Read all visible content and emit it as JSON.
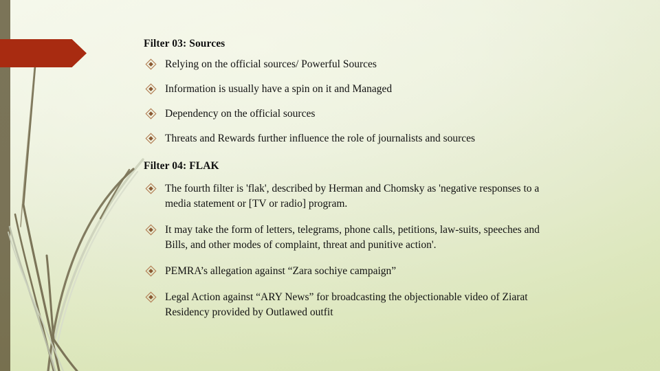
{
  "slide": {
    "background_color": "#e9eed8",
    "left_bar_color": "#7b7458",
    "accent_color": "#a82b11",
    "bullet_glyph": "diamond-in-diamond",
    "bullet_glyph_color": "#b5835a"
  },
  "sections": [
    {
      "heading": "Filter 03: Sources",
      "bullets": [
        {
          "text": "Relying on the official sources/ Powerful Sources",
          "justified": false
        },
        {
          "text": "Information is usually have a spin on it  and Managed",
          "justified": false
        },
        {
          "text": "Dependency on the official sources",
          "justified": false
        },
        {
          "text": "Threats and Rewards further influence the role of journalists and sources",
          "justified": false
        }
      ]
    },
    {
      "heading": "Filter 04: FLAK",
      "bullets": [
        {
          "text": "The fourth filter is 'flak', described by Herman and Chomsky as 'negative responses to a",
          "last_line": "media statement or [TV or radio] program.",
          "justified": true
        },
        {
          "text": "It may take the form of letters, telegrams, phone calls, petitions, law-suits, speeches and",
          "last_line": "Bills, and other modes of complaint, threat and punitive action'.",
          "justified": true
        },
        {
          "text": "PEMRA’s allegation against “Zara sochiye campaign”",
          "justified": false
        },
        {
          "text": "Legal Action against “ARY News” for broadcasting the objectionable video of Ziarat",
          "last_line": "Residency provided by Outlawed outfit",
          "justified": true
        }
      ]
    }
  ]
}
